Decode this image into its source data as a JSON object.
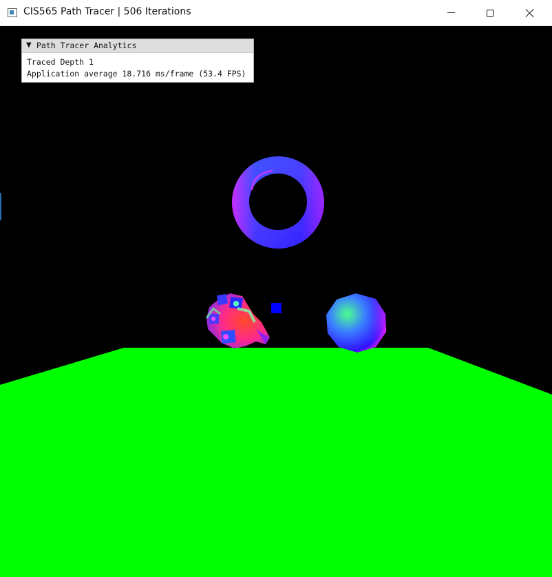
{
  "window": {
    "title": "CIS565 Path Tracer | 506 Iterations",
    "icon": "app-window-icon",
    "controls": {
      "minimize_icon": "minimize-icon",
      "maximize_icon": "maximize-icon",
      "close_icon": "close-icon"
    }
  },
  "analytics_panel": {
    "collapse_icon": "triangle-down-icon",
    "title": "Path Tracer Analytics",
    "lines": [
      "Traced Depth 1",
      "Application average 18.716 ms/frame (53.4 FPS)"
    ]
  },
  "scene": {
    "background_color": "#000000",
    "floor_color": "#00ff00",
    "objects": [
      "torus",
      "character-mesh",
      "small-cube",
      "sphere",
      "floor-plane"
    ]
  }
}
